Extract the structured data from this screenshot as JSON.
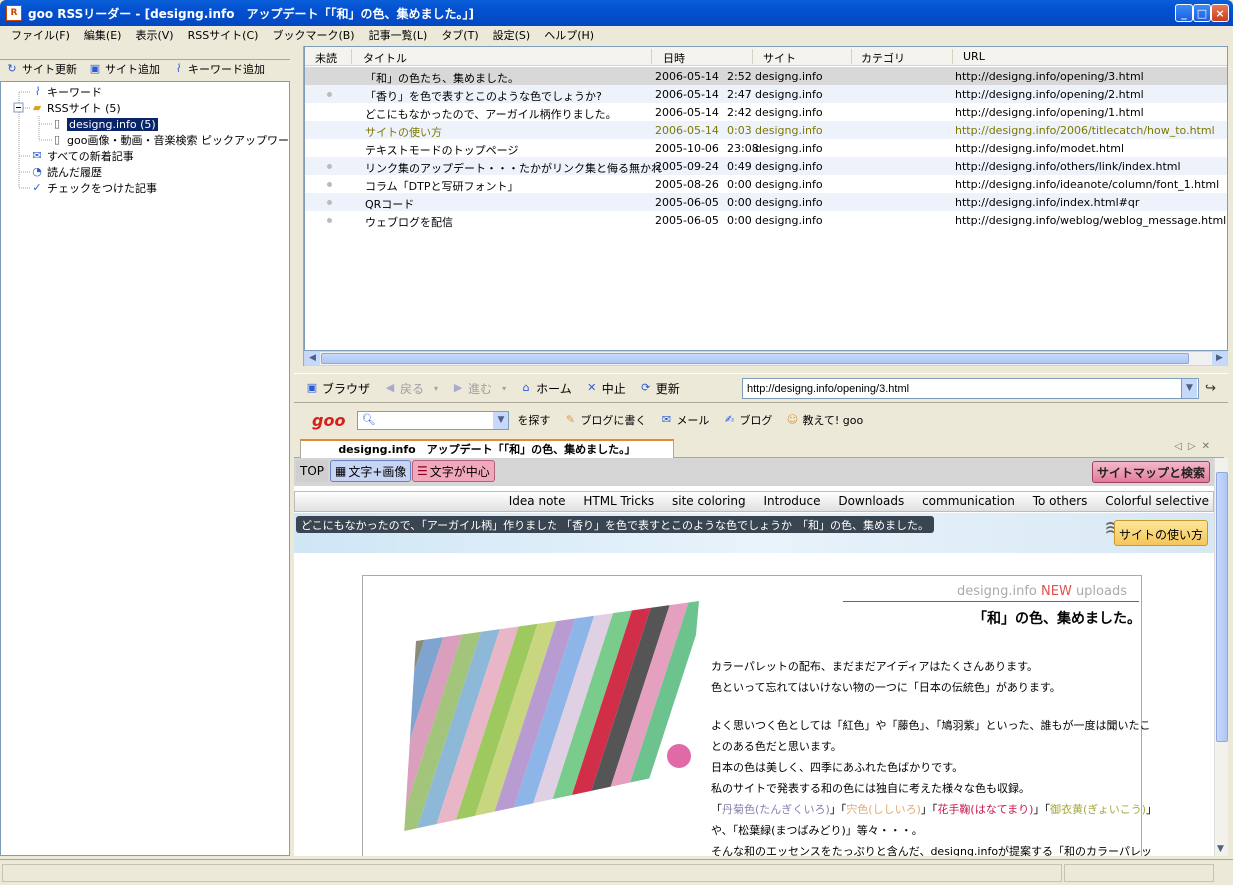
{
  "window": {
    "title": "goo RSSリーダー - [designg.info　アップデート「「和」の色、集めました。」]"
  },
  "menu": [
    "ファイル(F)",
    "編集(E)",
    "表示(V)",
    "RSSサイト(C)",
    "ブックマーク(B)",
    "記事一覧(L)",
    "タブ(T)",
    "設定(S)",
    "ヘルプ(H)"
  ],
  "left_toolbar": {
    "update": "サイト更新",
    "add_site": "サイト追加",
    "add_keyword": "キーワード追加"
  },
  "tree": [
    {
      "label": "キーワード",
      "icon": "keyword-icon"
    },
    {
      "label": "RSSサイト (5)",
      "icon": "folder-icon"
    },
    {
      "label": "designg.info (5)",
      "icon": "page-icon",
      "selected": true
    },
    {
      "label": "goo画像・動画・音楽検索 ピックアップワード",
      "icon": "page-icon"
    },
    {
      "label": "すべての新着記事",
      "icon": "new-articles-icon"
    },
    {
      "label": "読んだ履歴",
      "icon": "history-icon"
    },
    {
      "label": "チェックをつけた記事",
      "icon": "check-icon"
    }
  ],
  "grid": {
    "headers": [
      "未読",
      "タイトル",
      "日時",
      "サイト",
      "カテゴリ",
      "URL"
    ],
    "rows": [
      {
        "unread": false,
        "title": "「和」の色たち、集めました。",
        "date": "2006-05-14",
        "time": "2:52",
        "site": "designg.info",
        "url": "http://designg.info/opening/3.html"
      },
      {
        "unread": true,
        "title": "「香り」を色で表すとこのような色でしょうか?",
        "date": "2006-05-14",
        "time": "2:47",
        "site": "designg.info",
        "url": "http://designg.info/opening/2.html"
      },
      {
        "unread": false,
        "title": "どこにもなかったので、アーガイル柄作りました。",
        "date": "2006-05-14",
        "time": "2:42",
        "site": "designg.info",
        "url": "http://designg.info/opening/1.html"
      },
      {
        "unread": false,
        "title": "サイトの使い方",
        "date": "2006-05-14",
        "time": "0:03",
        "site": "designg.info",
        "url": "http://designg.info/2006/titlecatch/how_to.html"
      },
      {
        "unread": false,
        "title": "テキストモードのトップページ",
        "date": "2005-10-06",
        "time": "23:08",
        "site": "designg.info",
        "url": "http://designg.info/modet.html"
      },
      {
        "unread": true,
        "title": "リンク集のアップデート・・・たかがリンク集と侮る無かれ",
        "date": "2005-09-24",
        "time": "0:49",
        "site": "designg.info",
        "url": "http://designg.info/others/link/index.html"
      },
      {
        "unread": true,
        "title": "コラム「DTPと写研フォント」",
        "date": "2005-08-26",
        "time": "0:00",
        "site": "designg.info",
        "url": "http://designg.info/ideanote/column/font_1.html"
      },
      {
        "unread": true,
        "title": "QRコード",
        "date": "2005-06-05",
        "time": "0:00",
        "site": "designg.info",
        "url": "http://designg.info/index.html#qr"
      },
      {
        "unread": true,
        "title": "ウェブログを配信",
        "date": "2005-06-05",
        "time": "0:00",
        "site": "designg.info",
        "url": "http://designg.info/weblog/weblog_message.html"
      }
    ]
  },
  "nav": {
    "browser": "ブラウザ",
    "back": "戻る",
    "forward": "進む",
    "home": "ホーム",
    "stop": "中止",
    "refresh": "更新",
    "url": "http://designg.info/opening/3.html"
  },
  "goo": {
    "logo": "goo",
    "search": "を探す",
    "blog_write": "ブログに書く",
    "mail": "メール",
    "blog": "ブログ",
    "oshiete": "教えて! goo"
  },
  "tab": {
    "label": "designg.info　アップデート「「和」の色、集めました。」"
  },
  "web": {
    "top": "TOP",
    "btn_text_image": "文字+画像",
    "btn_text_center": "文字が中心",
    "sitemap": "サイトマップと検索",
    "nav": [
      "Idea note",
      "HTML Tricks",
      "site coloring",
      "Introduce",
      "Downloads",
      "communication",
      "To others",
      "Colorful selective"
    ],
    "pills": [
      "どこにもなかったので、「アーガイル柄」作りました。",
      "「香り」を色で表すとこのような色でしょうか?",
      "「和」の色、集めました。"
    ],
    "howto": "サイトの使い方",
    "art_head_site": "designg.info",
    "art_head_new": "NEW",
    "art_head_uploads": "uploads",
    "art_title": "「和」の色、集めました。",
    "body": [
      "カラーパレットの配布、まだまだアイディアはたくさんあります。",
      "色といって忘れてはいけない物の一つに「日本の伝統色」があります。",
      "",
      "よく思いつく色としては「紅色」や「藤色」、「鳩羽紫」といった、誰もが一度は聞いたこ",
      "とのある色だと思います。",
      "日本の色は美しく、四季にあふれた色ばかりです。",
      "私のサイトで発表する和の色には独自に考えた様々な色も収録。"
    ],
    "colors_line": {
      "c1": "丹菊色(たんぎくいろ)",
      "c2": "宍色(ししいろ)",
      "c3": "花手鞠(はなてまり)",
      "c4": "御衣黄(ぎょいこう)"
    },
    "line_after": "や、「松葉緑(まつばみどり)」等々・・・。",
    "line_last": "そんな和のエッセンスをたっぷりと含んだ、designg.infoが提案する「和のカラーパレッ"
  },
  "colors": {
    "accent": "#0a246a",
    "olive": "#7a7a00",
    "red": "#d5201d"
  }
}
